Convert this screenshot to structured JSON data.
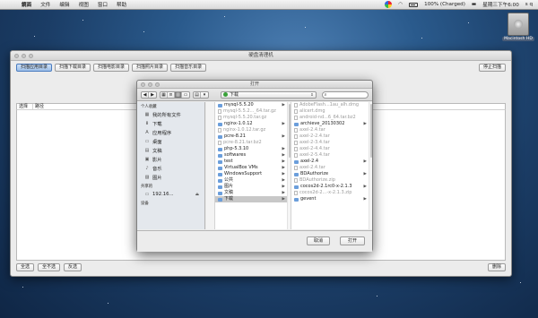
{
  "menubar": {
    "apple": "",
    "app_name": "鏡面",
    "items": [
      "文件",
      "编辑",
      "视图",
      "窗口",
      "帮助"
    ],
    "battery": "100% (Charged)",
    "clock": "星期三下午6:00",
    "user": "s q"
  },
  "desktop": {
    "hd_label": "Macintosh HD"
  },
  "main_window": {
    "title": "硬盘清理机",
    "tabs": [
      "扫描应用目录",
      "扫描下载目录",
      "扫描电影目录",
      "扫描照片目录",
      "扫描音乐目录"
    ],
    "active_tab": 0,
    "stop_button": "停止扫描",
    "columns": [
      "选择",
      "路径"
    ],
    "bottom_buttons": [
      "全选",
      "全不选",
      "反选"
    ],
    "delete_button": "删除"
  },
  "dialog": {
    "title": "打开",
    "location": "下载",
    "search_placeholder": "",
    "sidebar": {
      "favorites_header": "个人收藏",
      "favorites": [
        {
          "label": "我的所有文件",
          "icon": "all-files-icon",
          "glyph": "▦"
        },
        {
          "label": "下载",
          "icon": "download-icon",
          "glyph": "⬇"
        },
        {
          "label": "应用程序",
          "icon": "applications-icon",
          "glyph": "A"
        },
        {
          "label": "桌面",
          "icon": "desktop-icon",
          "glyph": "▭"
        },
        {
          "label": "文稿",
          "icon": "documents-icon",
          "glyph": "▤"
        },
        {
          "label": "影片",
          "icon": "movies-icon",
          "glyph": "▣"
        },
        {
          "label": "音乐",
          "icon": "music-icon",
          "glyph": "♪"
        },
        {
          "label": "图片",
          "icon": "pictures-icon",
          "glyph": "▨"
        }
      ],
      "shared_header": "共享的",
      "shared": [
        {
          "label": "192.16...",
          "icon": "network-icon",
          "glyph": "▭"
        }
      ],
      "devices_header": "设备"
    },
    "column2": [
      {
        "name": "mysql-5.5.20",
        "type": "folder",
        "dim": false,
        "arrow": true
      },
      {
        "name": "mysql-5.5.2..._64.tar.gz",
        "type": "file",
        "dim": true,
        "arrow": false
      },
      {
        "name": "mysql-5.5.20.tar.gz",
        "type": "file",
        "dim": true,
        "arrow": false
      },
      {
        "name": "nginx-1.0.12",
        "type": "folder",
        "dim": false,
        "arrow": true
      },
      {
        "name": "nginx-1.0.12.tar.gz",
        "type": "file",
        "dim": true,
        "arrow": false
      },
      {
        "name": "pcre-8.21",
        "type": "folder",
        "dim": false,
        "arrow": true
      },
      {
        "name": "pcre-8.21.tar.bz2",
        "type": "file",
        "dim": true,
        "arrow": false
      },
      {
        "name": "php-5.3.10",
        "type": "folder",
        "dim": false,
        "arrow": true
      },
      {
        "name": "softwares",
        "type": "folder",
        "dim": false,
        "arrow": true
      },
      {
        "name": "test",
        "type": "folder",
        "dim": false,
        "arrow": true
      },
      {
        "name": "VirtualBox VMs",
        "type": "folder",
        "dim": false,
        "arrow": true
      },
      {
        "name": "WindowsSupport",
        "type": "folder",
        "dim": false,
        "arrow": true
      },
      {
        "name": "公共",
        "type": "folder",
        "dim": false,
        "arrow": true
      },
      {
        "name": "图片",
        "type": "folder",
        "dim": false,
        "arrow": true
      },
      {
        "name": "文稿",
        "type": "folder",
        "dim": false,
        "arrow": true
      },
      {
        "name": "下载",
        "type": "folder",
        "dim": false,
        "arrow": true,
        "selected": true
      }
    ],
    "column3": [
      {
        "name": "AdobeFlash...1au_alh.dmg",
        "type": "file",
        "dim": true,
        "arrow": false
      },
      {
        "name": "alicert.dmg",
        "type": "file",
        "dim": true,
        "arrow": false
      },
      {
        "name": "android-nd...6_64.tar.bz2",
        "type": "file",
        "dim": true,
        "arrow": false
      },
      {
        "name": "archieve_20130302",
        "type": "folder",
        "dim": false,
        "arrow": true
      },
      {
        "name": "axel-2.4.tar",
        "type": "file",
        "dim": true,
        "arrow": false
      },
      {
        "name": "axel-2-2.4.tar",
        "type": "file",
        "dim": true,
        "arrow": false
      },
      {
        "name": "axel-2-3.4.tar",
        "type": "file",
        "dim": true,
        "arrow": false
      },
      {
        "name": "axel-2-4.4.tar",
        "type": "file",
        "dim": true,
        "arrow": false
      },
      {
        "name": "axel-2-5.4.tar",
        "type": "file",
        "dim": true,
        "arrow": false
      },
      {
        "name": "axel-2.4",
        "type": "folder",
        "dim": false,
        "arrow": true
      },
      {
        "name": "axel-2.4.tar",
        "type": "file",
        "dim": true,
        "arrow": false
      },
      {
        "name": "BDAuthorize",
        "type": "folder",
        "dim": false,
        "arrow": true
      },
      {
        "name": "BDAuthorize.zip",
        "type": "file",
        "dim": true,
        "arrow": false
      },
      {
        "name": "cocos2d-2.1rc0-x-2.1.3",
        "type": "folder",
        "dim": false,
        "arrow": true
      },
      {
        "name": "cocos2d-2...-x-2.1.3.zip",
        "type": "file",
        "dim": true,
        "arrow": false
      },
      {
        "name": "gevent",
        "type": "folder",
        "dim": false,
        "arrow": true
      }
    ],
    "cancel_button": "取消",
    "open_button": "打开"
  }
}
